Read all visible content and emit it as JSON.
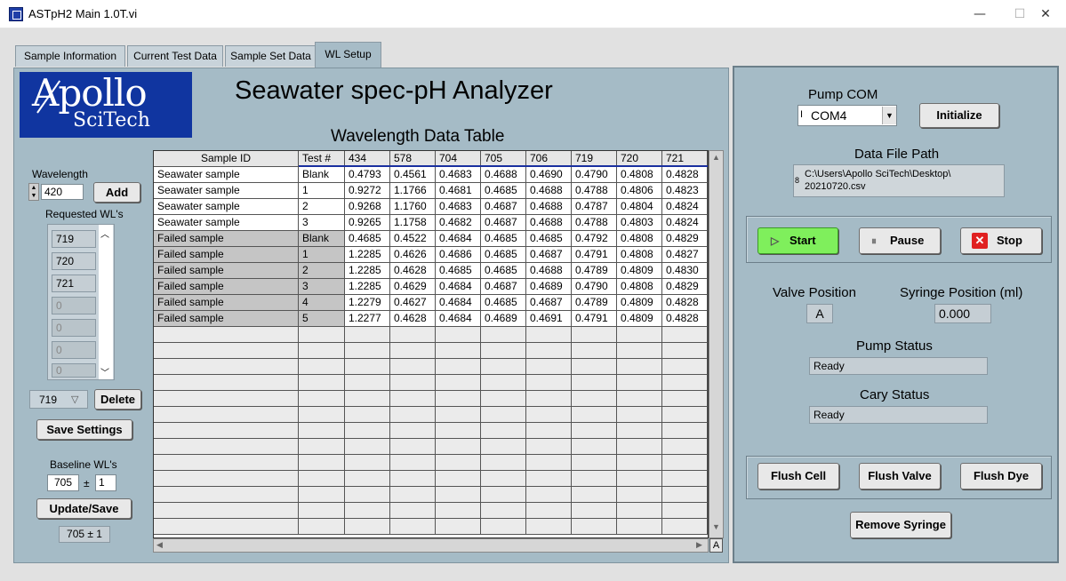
{
  "window": {
    "title": "ASTpH2 Main 1.0T.vi",
    "min": "—",
    "max": "☐",
    "close": "✕"
  },
  "tabs": [
    "Sample Information",
    "Current Test Data",
    "Sample Set Data",
    "WL Setup"
  ],
  "logo": {
    "top": "Apollo",
    "bottom": "SciTech"
  },
  "app_title": "Seawater spec-pH Analyzer",
  "wavelength": {
    "label": "Wavelength",
    "value": "420",
    "add_label": "Add",
    "requested_label": "Requested WL's",
    "requested": [
      "719",
      "720",
      "721",
      "0",
      "0",
      "0",
      "0"
    ],
    "selected": "719",
    "delete_label": "Delete",
    "save_label": "Save Settings",
    "baseline_label": "Baseline WL's",
    "baseline_value": "705",
    "pm": "±",
    "baseline_tol": "1",
    "update_label": "Update/Save",
    "baseline_display": "705 ± 1"
  },
  "table": {
    "title": "Wavelength Data Table",
    "headers": [
      "Sample ID",
      "Test #",
      "434",
      "578",
      "704",
      "705",
      "706",
      "719",
      "720",
      "721"
    ],
    "rows": [
      [
        "Seawater sample",
        "Blank",
        "0.4793",
        "0.4561",
        "0.4683",
        "0.4688",
        "0.4690",
        "0.4790",
        "0.4808",
        "0.4828"
      ],
      [
        "Seawater sample",
        "1",
        "0.9272",
        "1.1766",
        "0.4681",
        "0.4685",
        "0.4688",
        "0.4788",
        "0.4806",
        "0.4823"
      ],
      [
        "Seawater sample",
        "2",
        "0.9268",
        "1.1760",
        "0.4683",
        "0.4687",
        "0.4688",
        "0.4787",
        "0.4804",
        "0.4824"
      ],
      [
        "Seawater sample",
        "3",
        "0.9265",
        "1.1758",
        "0.4682",
        "0.4687",
        "0.4688",
        "0.4788",
        "0.4803",
        "0.4824"
      ],
      [
        "Failed sample",
        "Blank",
        "0.4685",
        "0.4522",
        "0.4684",
        "0.4685",
        "0.4685",
        "0.4792",
        "0.4808",
        "0.4829"
      ],
      [
        "Failed sample",
        "1",
        "1.2285",
        "0.4626",
        "0.4686",
        "0.4685",
        "0.4687",
        "0.4791",
        "0.4808",
        "0.4827"
      ],
      [
        "Failed sample",
        "2",
        "1.2285",
        "0.4628",
        "0.4685",
        "0.4685",
        "0.4688",
        "0.4789",
        "0.4809",
        "0.4830"
      ],
      [
        "Failed sample",
        "3",
        "1.2285",
        "0.4629",
        "0.4684",
        "0.4687",
        "0.4689",
        "0.4790",
        "0.4808",
        "0.4829"
      ],
      [
        "Failed sample",
        "4",
        "1.2279",
        "0.4627",
        "0.4684",
        "0.4685",
        "0.4687",
        "0.4789",
        "0.4809",
        "0.4828"
      ],
      [
        "Failed sample",
        "5",
        "1.2277",
        "0.4628",
        "0.4684",
        "0.4689",
        "0.4691",
        "0.4791",
        "0.4809",
        "0.4828"
      ]
    ],
    "corner_label": "A"
  },
  "right": {
    "pump_com_label": "Pump COM",
    "pump_com_prefix": "I",
    "pump_com_value": "COM4",
    "initialize_label": "Initialize",
    "data_file_label": "Data File Path",
    "data_file_prefix": "8",
    "data_file_line1": "C:\\Users\\Apollo SciTech\\Desktop\\",
    "data_file_line2": "20210720.csv",
    "start_label": "Start",
    "pause_label": "Pause",
    "stop_label": "Stop",
    "valve_label": "Valve Position",
    "valve_value": "A",
    "syringe_label": "Syringe Position (ml)",
    "syringe_value": "0.000",
    "pump_status_label": "Pump Status",
    "pump_status_value": "Ready",
    "cary_status_label": "Cary Status",
    "cary_status_value": "Ready",
    "flush_cell_label": "Flush Cell",
    "flush_valve_label": "Flush Valve",
    "flush_dye_label": "Flush Dye",
    "remove_syringe_label": "Remove Syringe"
  }
}
